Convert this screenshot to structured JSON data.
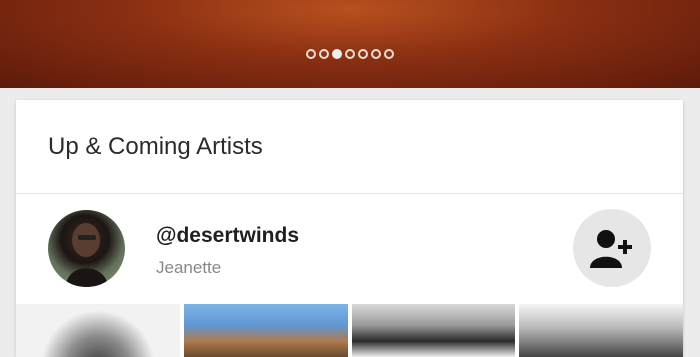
{
  "carousel": {
    "page_count": 7,
    "active_index": 2
  },
  "section": {
    "title": "Up & Coming Artists"
  },
  "artist": {
    "handle": "@desertwinds",
    "name": "Jeanette",
    "follow_icon": "add-user-icon"
  },
  "thumbnails": [
    {
      "icon": "photo-thumbnail"
    },
    {
      "icon": "photo-thumbnail"
    },
    {
      "icon": "photo-thumbnail"
    },
    {
      "icon": "photo-thumbnail"
    }
  ],
  "colors": {
    "hero": "#8a2f12",
    "card": "#ffffff",
    "follow_button_bg": "#e6e6e6"
  }
}
